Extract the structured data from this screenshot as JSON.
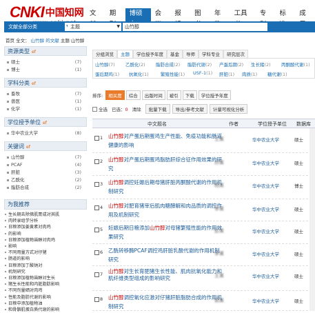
{
  "logo": {
    "mark": "CNKI",
    "cn": "中国知网",
    "url": "www.cnki.net"
  },
  "nav": [
    "文献",
    "期刊",
    "博硕士",
    "会议",
    "报纸",
    "图书",
    "年鉴",
    "工具书",
    "专利",
    "标准",
    "成果"
  ],
  "nav_active": 2,
  "search": {
    "category": "文献全部分类",
    "field": "主题",
    "keyword": "山竹醇"
  },
  "breadcrumb": {
    "prefix": "首页 全文：",
    "path": "山竹醇 的文献",
    "suffix": "主题 山竹醇"
  },
  "sidebar": {
    "resource": {
      "title": "资源类型",
      "tag": "ef",
      "items": [
        {
          "label": "硕士",
          "count": "(7)"
        },
        {
          "label": "博士",
          "count": "(1)"
        }
      ]
    },
    "subject": {
      "title": "学科分类",
      "tag": "ef",
      "items": [
        {
          "label": "畜牧",
          "count": "(7)"
        },
        {
          "label": "兽医",
          "count": "(1)"
        },
        {
          "label": "化学",
          "count": "(1)"
        }
      ]
    },
    "unit": {
      "title": "学位授予单位",
      "tag": "ef",
      "items": [
        {
          "label": "华中农业大学",
          "count": "(8)"
        }
      ]
    },
    "keywords": {
      "title": "关键词",
      "tag": "ef",
      "items": [
        {
          "label": "山竹醇",
          "count": "(7)"
        },
        {
          "label": "PCAF",
          "count": "(4)"
        },
        {
          "label": "肝脏",
          "count": "(3)"
        },
        {
          "label": "乙酰化",
          "count": "(2)"
        },
        {
          "label": "脂肪合成",
          "count": "(2)"
        }
      ]
    }
  },
  "recommend": {
    "title": "为我推荐",
    "items": [
      "生长期去除佛肌胃成对其肌",
      "肉转录组学分析",
      "日粮添加姜黄素对肉鸡",
      "的影响",
      "日粮添加植物甾醇对肉鸡",
      "影响",
      "不同用量方式对仔猪",
      "肠道的影响",
      "日粮添加丁酸钠对",
      "机制研究",
      "日粮添加植物甾醇对生长",
      "猪生长性能和内脏脂肪影响",
      "不同剂量硒对肉鸡",
      "性能及脂肪代谢的影响",
      "日粮中添加植物油",
      "和骨骼肌蛋白质代谢的影响"
    ]
  },
  "group_tabs": [
    "分组浏览",
    "主题",
    "学位授予年度",
    "基金",
    "导师",
    "学科专业",
    "研究层次"
  ],
  "group_tab_active": 1,
  "group_items": [
    {
      "label": "山竹醇",
      "count": "(7)"
    },
    {
      "label": "乙酰化",
      "count": "(2)"
    },
    {
      "label": "脂肪合成",
      "count": "(2)"
    },
    {
      "label": "脂肪代谢",
      "count": "(2)"
    },
    {
      "label": "产蛋后期",
      "count": "(2)"
    },
    {
      "label": "生长猪",
      "count": "(2)"
    },
    {
      "label": "丙酮酸代谢",
      "count": "(1)"
    },
    {
      "label": "蛋后期鸡",
      "count": "(1)"
    },
    {
      "label": "抗氧化",
      "count": "(1)"
    },
    {
      "label": "繁殖性能",
      "count": "(1)"
    },
    {
      "label": "USF-1",
      "count": "(1)"
    },
    {
      "label": "肝脏",
      "count": "(1)"
    },
    {
      "label": "肉质",
      "count": "(1)"
    },
    {
      "label": "糖代谢",
      "count": "(1)"
    }
  ],
  "sort": {
    "label": "排序:",
    "options": [
      "相关度",
      "综合",
      "出版时间",
      "被引",
      "下载",
      "学位授予年度"
    ],
    "active": 0
  },
  "toolbar": {
    "select_all": "全选",
    "selected_label": "已选：",
    "selected_count": "0",
    "clear": "清除",
    "batch_download": "批量下载",
    "export": "导出/参考文献",
    "analysis": "计量可视化分析"
  },
  "table": {
    "headers": [
      "中文题名",
      "作者",
      "学位授予单位",
      "数据库"
    ],
    "rows": [
      {
        "no": "1",
        "title_hl": "山竹醇",
        "title_rest": "对产蛋后期蛋鸡生产性能、免疫功能和肠道健康的影响",
        "author": "王某",
        "unit": "华中农业大学",
        "db": "硕士"
      },
      {
        "no": "2",
        "title_hl": "山竹醇",
        "title_rest": "对产蛋后期蛋鸡脂肪肝综合征作用效果的研究",
        "author": "孙某",
        "unit": "华中农业大学",
        "db": "硕士"
      },
      {
        "no": "3",
        "title_hl": "山竹醇",
        "title_rest": "调控妊娠后期母猪肝脏丙酮酸代谢的作用机制研究",
        "author": "杨某",
        "unit": "华中农业大学",
        "db": "博士"
      },
      {
        "no": "4",
        "title_hl": "山竹醇",
        "title_rest": "对肥育猪宰后肌肉糖酵解和肉品质的调控作用及机制研究",
        "author": "李某",
        "unit": "华中农业大学",
        "db": "硕士"
      },
      {
        "no": "5",
        "title_hl": "山竹醇",
        "title_rest": "妊娠后期日粮添加山竹醇对母猪繁殖性能的作用效果研究",
        "author": "彭某",
        "unit": "华中农业大学",
        "db": "硕士"
      },
      {
        "no": "6",
        "title_hl": "山竹醇",
        "title_rest": "乙酰转移酶PCAF调控鸡肝脏乳酸代谢的作用机制研究",
        "author": "李某",
        "unit": "华中农业大学",
        "db": "硕士"
      },
      {
        "no": "7",
        "title_hl": "山竹醇",
        "title_rest": "对生长育肥猪生长性能、肌肉抗氧化能力和肌纤维类型组成的影响研究",
        "author": "王某",
        "unit": "华中农业大学",
        "db": "硕士"
      },
      {
        "no": "8",
        "title_hl": "山竹醇",
        "title_rest": "调控氧化应激对仔猪肝脏脂肪合成的作用机制研究",
        "author": "郭某",
        "unit": "华中农业大学",
        "db": "硕士"
      }
    ]
  },
  "colors": {
    "brand_blue": "#1a6fb4",
    "logo_red": "#cc0000",
    "highlight_orange": "#e97b2a"
  }
}
